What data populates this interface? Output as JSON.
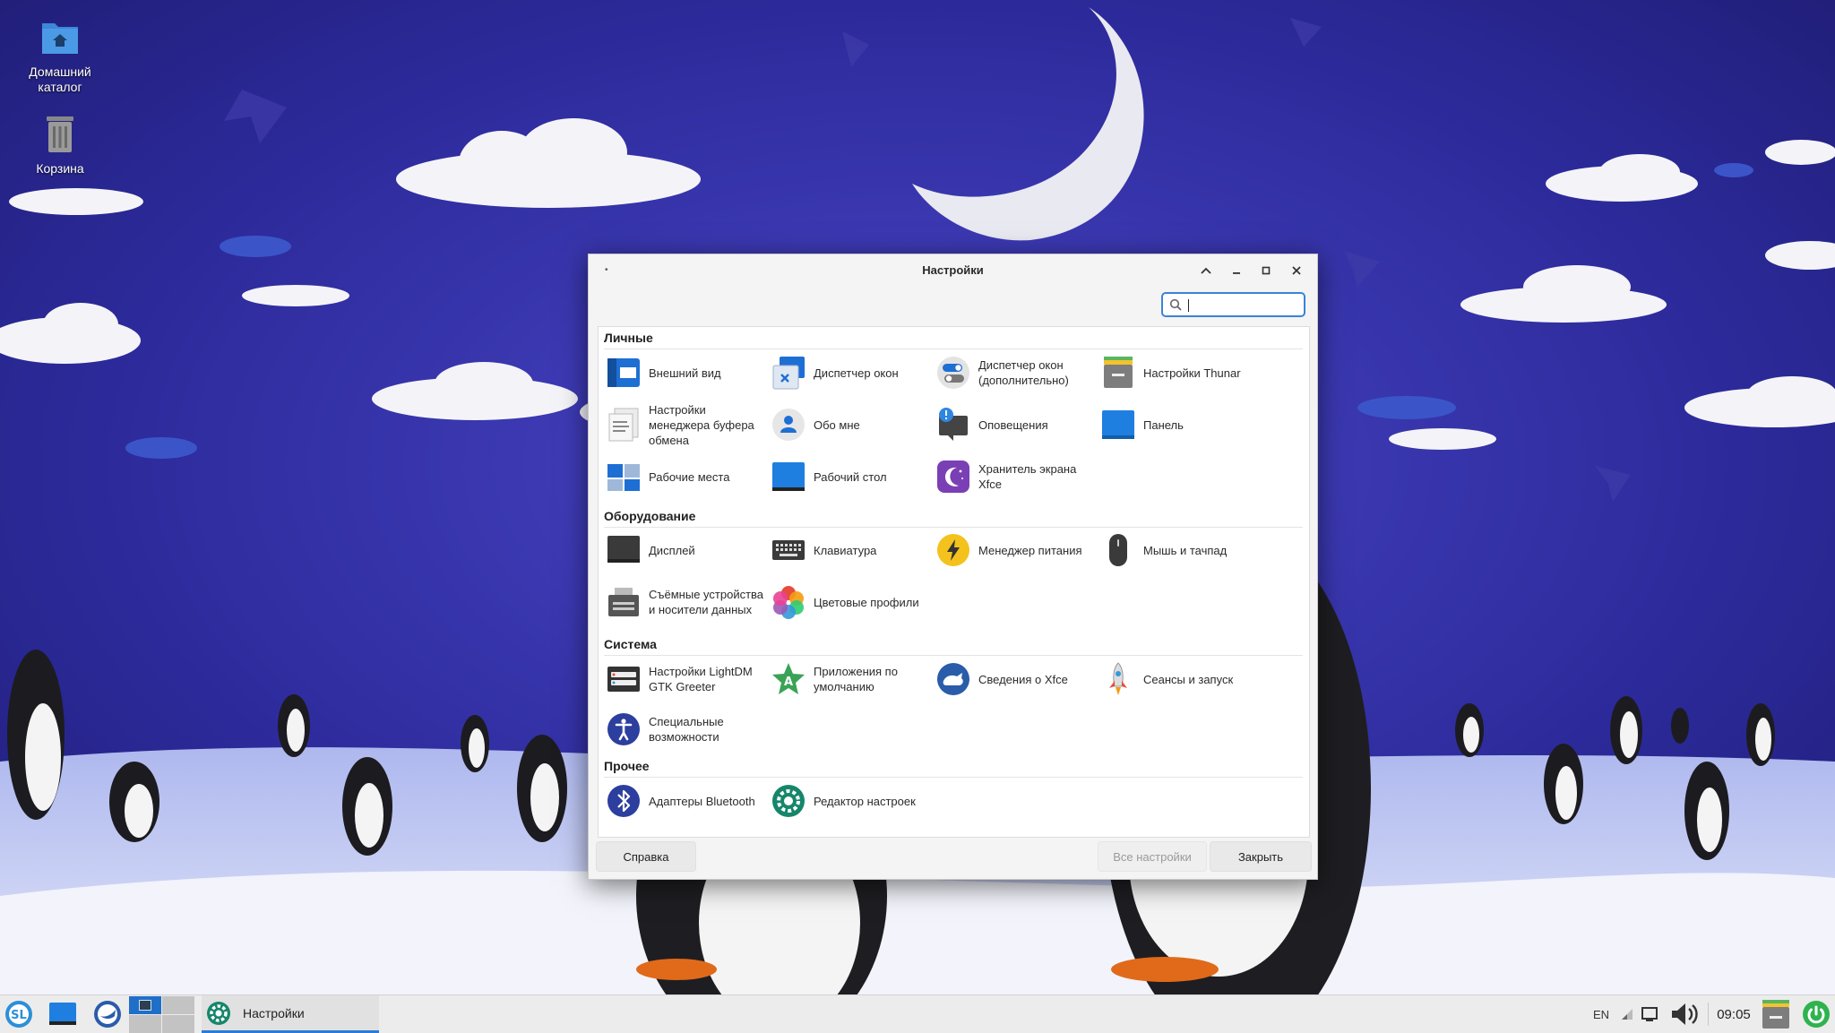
{
  "desktop": {
    "icons": [
      {
        "label": "Домашний каталог",
        "icon": "home-folder-icon"
      },
      {
        "label": "Корзина",
        "icon": "trash-icon"
      }
    ]
  },
  "window": {
    "title": "Настройки",
    "search": {
      "value": "",
      "placeholder": ""
    },
    "sections": [
      {
        "title": "Личные",
        "items": [
          {
            "label": "Внешний вид",
            "icon": "appearance-icon"
          },
          {
            "label": "Диспетчер окон",
            "icon": "window-manager-icon"
          },
          {
            "label": "Диспетчер окон (дополнительно)",
            "icon": "window-manager-tweaks-icon"
          },
          {
            "label": "Настройки Thunar",
            "icon": "thunar-icon"
          },
          {
            "label": "Настройки менеджера буфера обмена",
            "icon": "clipboard-icon"
          },
          {
            "label": "Обо мне",
            "icon": "about-me-icon"
          },
          {
            "label": "Оповещения",
            "icon": "notifications-icon"
          },
          {
            "label": "Панель",
            "icon": "panel-icon"
          },
          {
            "label": "Рабочие места",
            "icon": "workspaces-icon"
          },
          {
            "label": "Рабочий стол",
            "icon": "desktop-icon"
          },
          {
            "label": "Хранитель экрана Xfce",
            "icon": "screensaver-icon"
          }
        ]
      },
      {
        "title": "Оборудование",
        "items": [
          {
            "label": "Дисплей",
            "icon": "display-icon"
          },
          {
            "label": "Клавиатура",
            "icon": "keyboard-icon"
          },
          {
            "label": "Менеджер питания",
            "icon": "power-manager-icon"
          },
          {
            "label": "Мышь и тачпад",
            "icon": "mouse-icon"
          },
          {
            "label": "Съёмные устройства и носители данных",
            "icon": "removable-drives-icon"
          },
          {
            "label": "Цветовые профили",
            "icon": "color-profiles-icon"
          }
        ]
      },
      {
        "title": "Система",
        "items": [
          {
            "label": "Настройки LightDM GTK Greeter",
            "icon": "lightdm-icon"
          },
          {
            "label": "Приложения по умолчанию",
            "icon": "default-apps-icon"
          },
          {
            "label": "Сведения о Xfce",
            "icon": "xfce-about-icon"
          },
          {
            "label": "Сеансы и запуск",
            "icon": "session-startup-icon"
          },
          {
            "label": "Специальные возможности",
            "icon": "accessibility-icon"
          }
        ]
      },
      {
        "title": "Прочее",
        "items": [
          {
            "label": "Адаптеры Bluetooth",
            "icon": "bluetooth-icon"
          },
          {
            "label": "Редактор настроек",
            "icon": "settings-editor-icon"
          }
        ]
      }
    ],
    "buttons": {
      "help": "Справка",
      "all_settings": "Все настройки",
      "close": "Закрыть"
    }
  },
  "taskbar": {
    "task": {
      "label": "Настройки"
    },
    "layout": "EN",
    "clock": "09:05"
  },
  "colors": {
    "accent": "#3b83d6",
    "xfce_blue": "#1e77d3"
  }
}
